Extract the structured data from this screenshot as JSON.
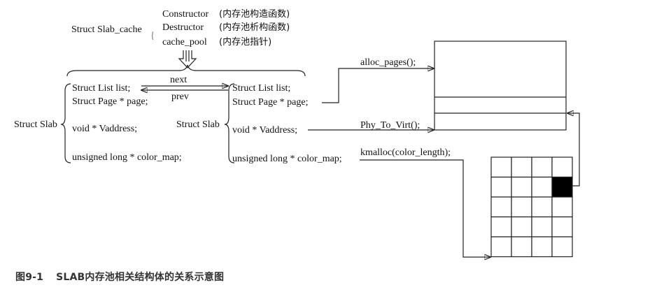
{
  "slab_cache": {
    "label": "Struct Slab_cache",
    "fields": [
      {
        "name": "Constructor",
        "note": "(内存池构造函数)"
      },
      {
        "name": "Destructor",
        "note": "(内存池析构函数)"
      },
      {
        "name": "cache_pool",
        "note": "(内存池指针)"
      }
    ]
  },
  "left_slab": {
    "label": "Struct Slab",
    "fields": [
      "Struct List list;",
      "Struct Page * page;",
      "void * Vaddress;",
      "unsigned long * color_map;"
    ]
  },
  "right_slab": {
    "label": "Struct Slab",
    "fields": [
      "Struct List list;",
      "Struct Page * page;",
      "void * Vaddress;",
      "unsigned long * color_map;"
    ]
  },
  "links": {
    "next": "next",
    "prev": "prev"
  },
  "functions": {
    "alloc": "alloc_pages();",
    "phy": "Phy_To_Virt();",
    "kmalloc": "kmalloc(color_length);"
  },
  "bitmap": {
    "rows": 5,
    "cols": 4,
    "filled": [
      [
        1,
        3
      ]
    ],
    "fill_color": "#000000"
  },
  "caption": {
    "number": "图9-1",
    "title": "SLAB内存池相关结构体的关系示意图"
  }
}
